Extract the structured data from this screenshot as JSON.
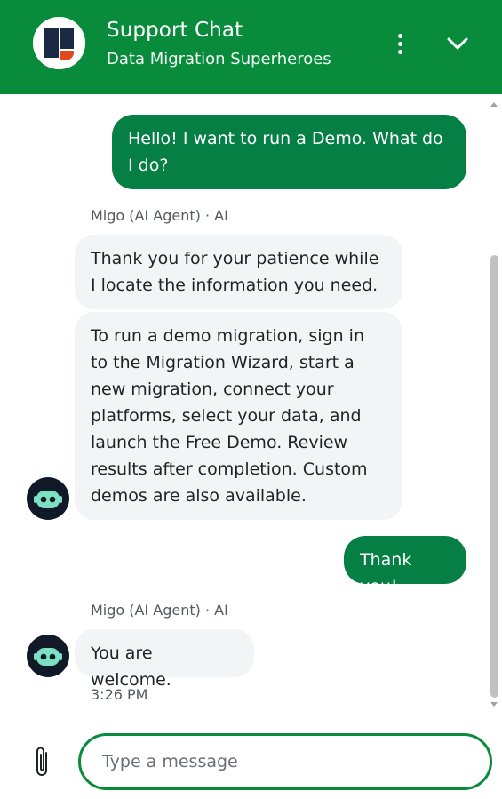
{
  "header": {
    "title": "Support Chat",
    "subtitle": "Data Migration Superheroes",
    "logo_icon": "brand-logo-icon",
    "menu_icon": "more-vertical-icon",
    "collapse_icon": "chevron-down-icon"
  },
  "messages": [
    {
      "role": "user",
      "text": "Hello! I want to run a Demo. What do I do?"
    },
    {
      "role": "agent",
      "sender": "Migo (AI Agent) · AI",
      "text": "Thank you for your patience while I locate the information you need."
    },
    {
      "role": "agent",
      "text": "To run a demo migration, sign in to the Migration Wizard, start a new migration, connect your platforms, select your data, and launch the Free Demo. Review results after completion. Custom demos are also available."
    },
    {
      "role": "user",
      "text": "Thank you!"
    },
    {
      "role": "agent",
      "sender": "Migo (AI Agent) · AI",
      "text": "You are welcome."
    }
  ],
  "last_timestamp": "3:26 PM",
  "composer": {
    "placeholder": "Type a message",
    "attach_icon": "paperclip-icon"
  },
  "colors": {
    "header_bg": "#098b3c",
    "user_bubble": "#067f45",
    "agent_bubble": "#f3f4f6",
    "input_border": "#098b3c"
  }
}
